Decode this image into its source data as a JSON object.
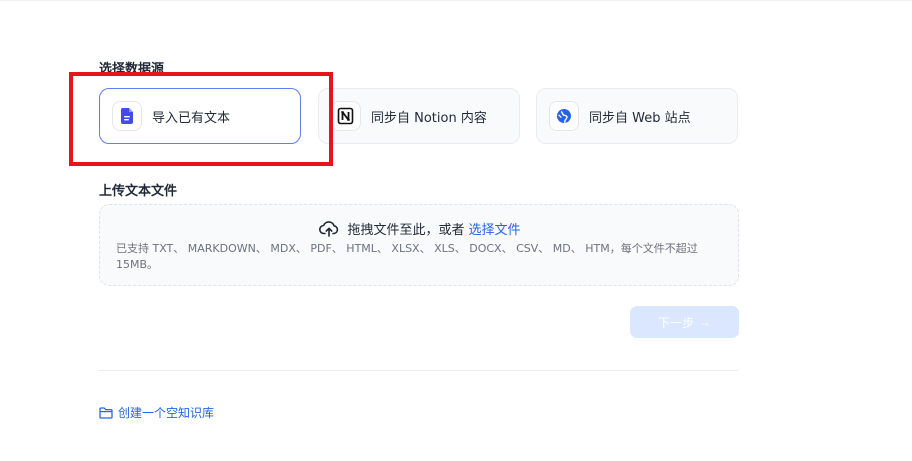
{
  "datasource": {
    "title": "选择数据源",
    "options": [
      {
        "label": "导入已有文本",
        "icon": "document-icon",
        "selected": true
      },
      {
        "label": "同步自 Notion 内容",
        "icon": "notion-icon",
        "selected": false
      },
      {
        "label": "同步自 Web 站点",
        "icon": "web-globe-icon",
        "selected": false
      }
    ]
  },
  "upload": {
    "title": "上传文本文件",
    "drag_text": "拖拽文件至此，或者",
    "browse_link": "选择文件",
    "support_text": "已支持 TXT、 MARKDOWN、 MDX、 PDF、 HTML、 XLSX、 XLS、 DOCX、 CSV、 MD、 HTM，每个文件不超过 15MB。",
    "icon": "cloud-upload-icon"
  },
  "actions": {
    "next_label": "下一步",
    "next_arrow": "→",
    "create_empty_label": "创建一个空知识库",
    "create_icon": "folder-icon"
  },
  "colors": {
    "accent": "#2563eb",
    "selected_border": "#5d7ff0",
    "highlight": "#e8141b",
    "disabled_button": "#dbe7fe"
  }
}
